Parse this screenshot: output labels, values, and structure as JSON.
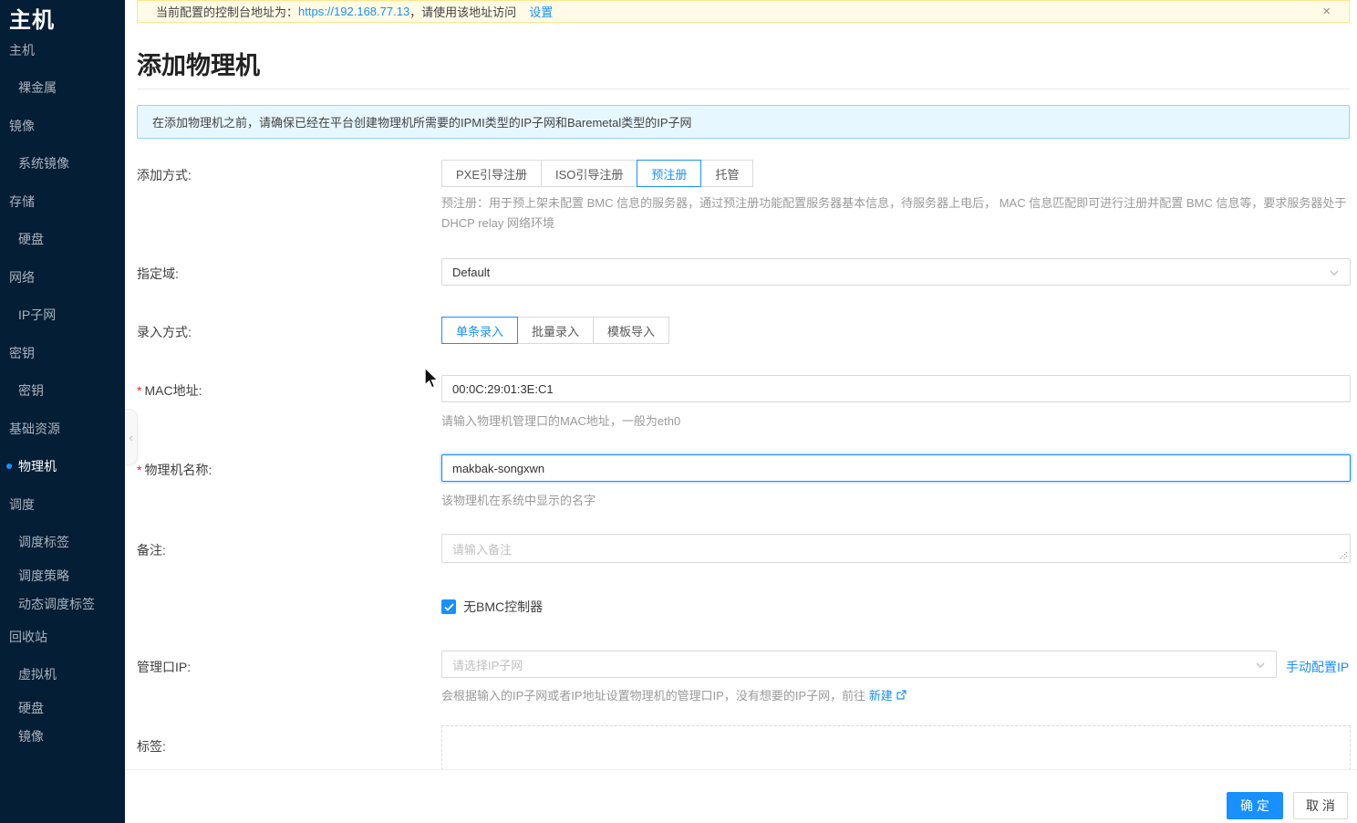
{
  "banner": {
    "prefix": "当前配置的控制台地址为：",
    "url": "https://192.168.77.13",
    "suffix": "，请使用该地址访问",
    "settings_link": "设置",
    "close_icon": "×"
  },
  "sidebar": {
    "title": "主机",
    "items": [
      {
        "label": "主机",
        "level": "group"
      },
      {
        "label": "裸金属",
        "level": "child"
      },
      {
        "label": "镜像",
        "level": "group"
      },
      {
        "label": "系统镜像",
        "level": "child"
      },
      {
        "label": "存储",
        "level": "group"
      },
      {
        "label": "硬盘",
        "level": "child"
      },
      {
        "label": "网络",
        "level": "group"
      },
      {
        "label": "IP子网",
        "level": "child"
      },
      {
        "label": "密钥",
        "level": "group"
      },
      {
        "label": "密钥",
        "level": "child"
      },
      {
        "label": "基础资源",
        "level": "group"
      },
      {
        "label": "物理机",
        "level": "child",
        "active": true
      },
      {
        "label": "调度",
        "level": "group"
      },
      {
        "label": "调度标签",
        "level": "child"
      },
      {
        "label": "调度策略",
        "level": "child"
      },
      {
        "label": "动态调度标签",
        "level": "child"
      },
      {
        "label": "回收站",
        "level": "group"
      },
      {
        "label": "虚拟机",
        "level": "child"
      },
      {
        "label": "硬盘",
        "level": "child"
      },
      {
        "label": "镜像",
        "level": "child"
      }
    ],
    "collapse_icon": "‹"
  },
  "page": {
    "title": "添加物理机",
    "alert": "在添加物理机之前，请确保已经在平台创建物理机所需要的IPMI类型的IP子网和Baremetal类型的IP子网"
  },
  "form": {
    "add_method": {
      "label": "添加方式:",
      "tabs": [
        "PXE引导注册",
        "ISO引导注册",
        "预注册",
        "托管"
      ],
      "active_tab": "预注册",
      "help": "预注册：用于预上架未配置 BMC 信息的服务器，通过预注册功能配置服务器基本信息，待服务器上电后， MAC 信息匹配即可进行注册并配置 BMC 信息等，要求服务器处于 DHCP relay 网络环境"
    },
    "zone": {
      "label": "指定域:",
      "value": "Default"
    },
    "entry_mode": {
      "label": "录入方式:",
      "tabs": [
        "单条录入",
        "批量录入",
        "模板导入"
      ],
      "active_tab": "单条录入"
    },
    "mac": {
      "required": "*",
      "label": "MAC地址:",
      "value": "00:0C:29:01:3E:C1",
      "help": "请输入物理机管理口的MAC地址，一般为eth0"
    },
    "name": {
      "required": "*",
      "label": "物理机名称:",
      "value": "makbak-songxwn",
      "help": "该物理机在系统中显示的名字"
    },
    "remark": {
      "label": "备注:",
      "placeholder": "请输入备注"
    },
    "no_bmc": {
      "label": "无BMC控制器",
      "checked": true
    },
    "mgmt_ip": {
      "label": "管理口IP:",
      "placeholder": "请选择IP子网",
      "manual_link": "手动配置IP",
      "help_prefix": "会根据输入的IP子网或者IP地址设置物理机的管理口IP，没有想要的IP子网，前往 ",
      "help_link": "新建"
    },
    "tags": {
      "label": "标签:"
    }
  },
  "footer": {
    "confirm": "确 定",
    "cancel": "取 消"
  },
  "colors": {
    "accent": "#1890ff",
    "sidebar_bg": "#041e36",
    "banner_bg": "#fffbe6",
    "banner_border": "#ffe58f",
    "alert_bg": "#e6f7ff",
    "alert_border": "#91d5ff",
    "required": "#f5222d"
  }
}
